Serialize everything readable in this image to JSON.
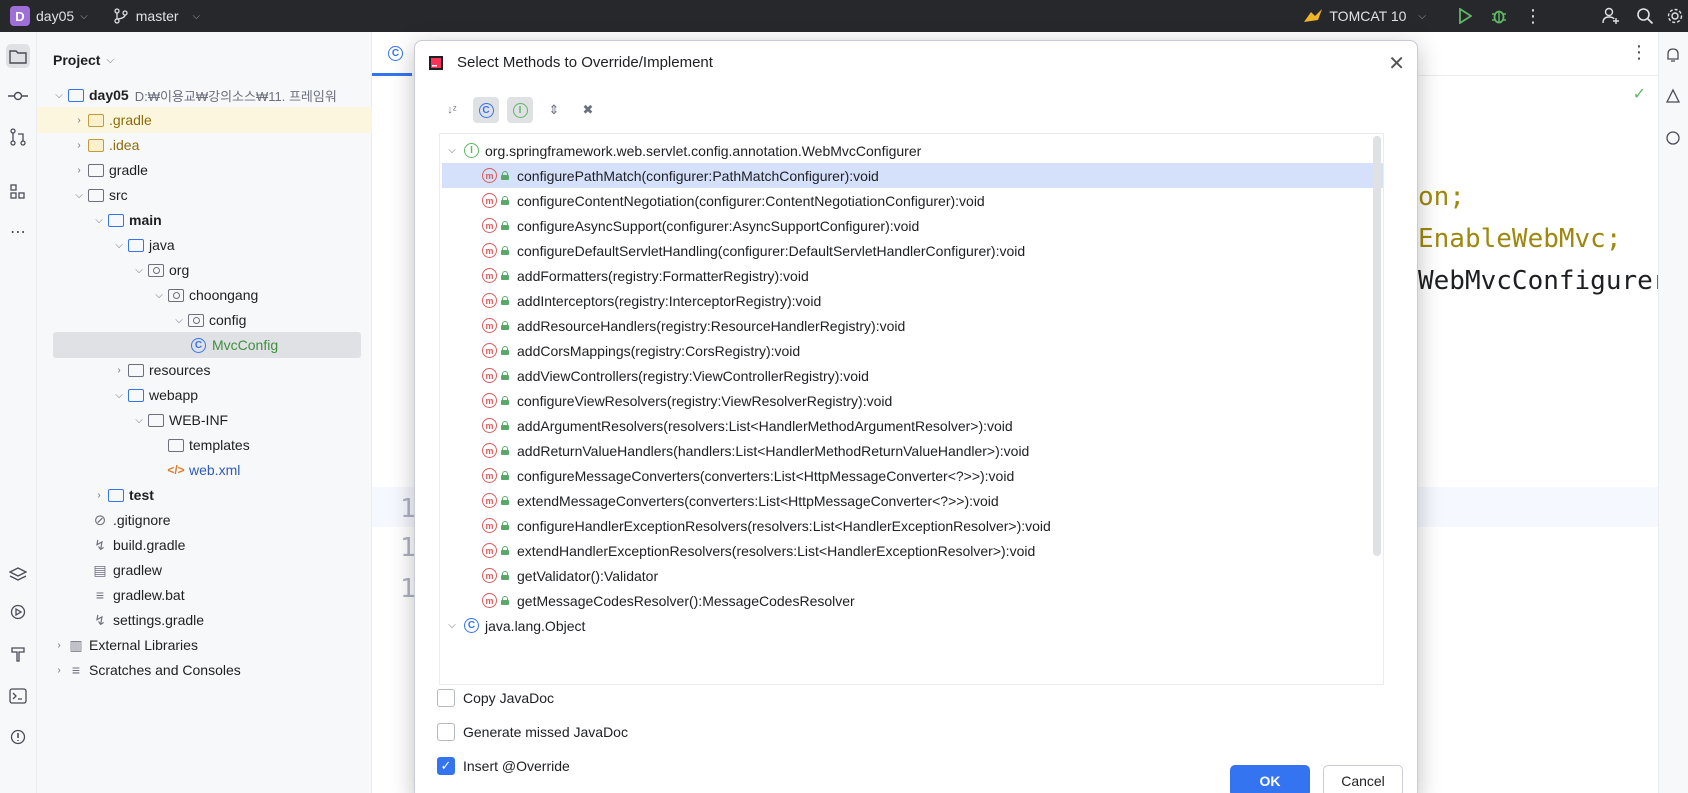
{
  "topbar": {
    "project_badge": "D",
    "project_name": "day05",
    "branch": "master",
    "run_config": "TOMCAT 10"
  },
  "project_panel": {
    "title": "Project",
    "tree": [
      {
        "label": "day05",
        "path": "D:₩이용교₩강의소스₩11. 프레임워",
        "bold": true
      },
      {
        "label": ".gradle"
      },
      {
        "label": ".idea"
      },
      {
        "label": "gradle"
      },
      {
        "label": "src"
      },
      {
        "label": "main",
        "bold": true
      },
      {
        "label": "java"
      },
      {
        "label": "org"
      },
      {
        "label": "choongang"
      },
      {
        "label": "config"
      },
      {
        "label": "MvcConfig"
      },
      {
        "label": "resources"
      },
      {
        "label": "webapp"
      },
      {
        "label": "WEB-INF"
      },
      {
        "label": "templates"
      },
      {
        "label": "web.xml"
      },
      {
        "label": "test",
        "bold": true
      },
      {
        "label": ".gitignore"
      },
      {
        "label": "build.gradle"
      },
      {
        "label": "gradlew"
      },
      {
        "label": "gradlew.bat"
      },
      {
        "label": "settings.gradle"
      },
      {
        "label": "External Libraries"
      },
      {
        "label": "Scratches and Consoles"
      }
    ]
  },
  "editor": {
    "code_lines": [
      "on;",
      "EnableWebMvc;",
      "WebMvcConfigurer"
    ],
    "gutter": [
      "1",
      "1",
      "1"
    ]
  },
  "dialog": {
    "title": "Select Methods to Override/Implement",
    "groups": [
      {
        "name": "org.springframework.web.servlet.config.annotation.WebMvcConfigurer",
        "methods": [
          "configurePathMatch(configurer:PathMatchConfigurer):void",
          "configureContentNegotiation(configurer:ContentNegotiationConfigurer):void",
          "configureAsyncSupport(configurer:AsyncSupportConfigurer):void",
          "configureDefaultServletHandling(configurer:DefaultServletHandlerConfigurer):void",
          "addFormatters(registry:FormatterRegistry):void",
          "addInterceptors(registry:InterceptorRegistry):void",
          "addResourceHandlers(registry:ResourceHandlerRegistry):void",
          "addCorsMappings(registry:CorsRegistry):void",
          "addViewControllers(registry:ViewControllerRegistry):void",
          "configureViewResolvers(registry:ViewResolverRegistry):void",
          "addArgumentResolvers(resolvers:List<HandlerMethodArgumentResolver>):void",
          "addReturnValueHandlers(handlers:List<HandlerMethodReturnValueHandler>):void",
          "configureMessageConverters(converters:List<HttpMessageConverter<?>>):void",
          "extendMessageConverters(converters:List<HttpMessageConverter<?>>):void",
          "configureHandlerExceptionResolvers(resolvers:List<HandlerExceptionResolver>):void",
          "extendHandlerExceptionResolvers(resolvers:List<HandlerExceptionResolver>):void",
          "getValidator():Validator",
          "getMessageCodesResolver():MessageCodesResolver"
        ]
      },
      {
        "name": "java.lang.Object"
      }
    ],
    "options": {
      "copy_javadoc": "Copy JavaDoc",
      "generate_javadoc": "Generate missed JavaDoc",
      "insert_override": "Insert @Override"
    },
    "ok": "OK",
    "cancel": "Cancel"
  }
}
